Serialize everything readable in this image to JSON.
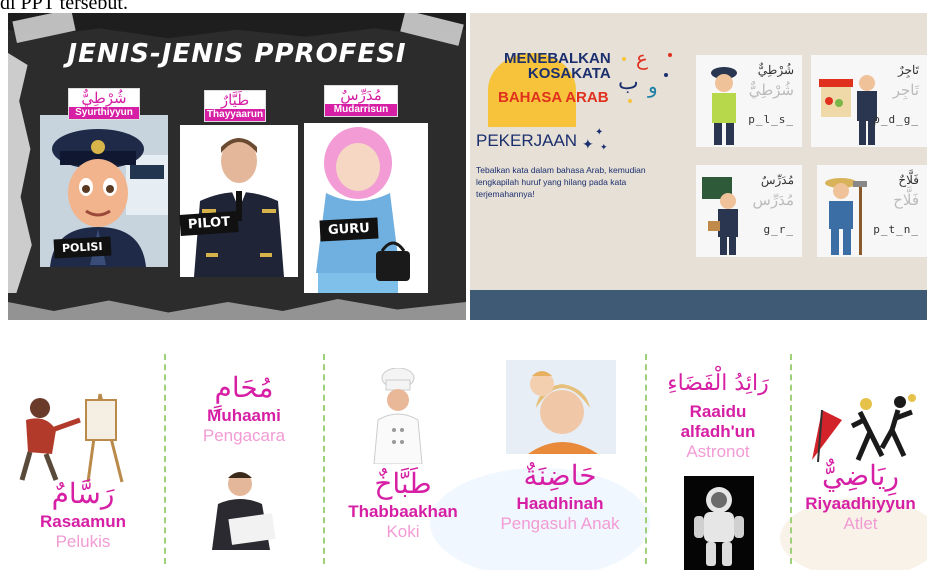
{
  "caption": "di PPT tersebut.",
  "slide1": {
    "title": "JENIS-JENIS PPROFESI",
    "cards": [
      {
        "arabic": "شُرْطِيٌّ",
        "latin": "Syurthiyyun",
        "label": "POLISI"
      },
      {
        "arabic": "طَيَّارٌ",
        "latin": "Thayyaarun",
        "label": "PILOT"
      },
      {
        "arabic": "مُدَرِّسٌ",
        "latin": "Mudarrisun",
        "label": "GURU"
      }
    ]
  },
  "slide2": {
    "title_line1": "MENEBALKAN",
    "title_line2": "KOSAKATA",
    "title_line3": "BAHASA ARAB",
    "subtitle": "PEKERJAAN",
    "instruction": "Tebalkan kata dalam bahasa Arab, kemudian lengkapilah huruf yang hilang pada kata terjemahannya!",
    "cards": [
      {
        "arabic": "شُرْطِيٌّ",
        "trace": "شُرْطِيٌّ",
        "hint": "p_l_s_"
      },
      {
        "arabic": "تَاجِرٌ",
        "trace": "تَاجِر",
        "hint": "p_d_g_"
      },
      {
        "arabic": "مُدَرِّسٌ",
        "trace": "مُدَرِّس",
        "hint": "g_r_"
      },
      {
        "arabic": "فَلَّاحٌ",
        "trace": "فَلَّاح",
        "hint": "p_t_n_"
      }
    ]
  },
  "strip": {
    "items": [
      {
        "arabic": "رَسَّامٌ",
        "latin": "Rasaamun",
        "indo": "Pelukis"
      },
      {
        "arabic": "مُحَامٍ",
        "latin": "Muhaami",
        "indo": "Pengacara"
      },
      {
        "arabic": "طَبَّاخٌ",
        "latin": "Thabbaakhan",
        "indo": "Koki"
      },
      {
        "arabic": "حَاضِنَةٌ",
        "latin": "Haadhinah",
        "indo": "Pengasuh Anak"
      },
      {
        "arabic": "رَائِدُ الْفَضَاءِ",
        "latin1": "Raaidu",
        "latin2": "alfadh'un",
        "indo": "Astronot"
      },
      {
        "arabic": "رِيَاضِيٌّ",
        "latin": "Riyaadhiyyun",
        "indo": "Atlet"
      }
    ]
  },
  "colors": {
    "magenta": "#d61fa4",
    "pink_light": "#f29bd4",
    "navy": "#1b2f6e",
    "red": "#e0301e",
    "yellow": "#f6c33b",
    "slide_dark": "#2c2c2c",
    "slide_beige": "#e6e0d6",
    "divider_green": "#9fd07a"
  }
}
